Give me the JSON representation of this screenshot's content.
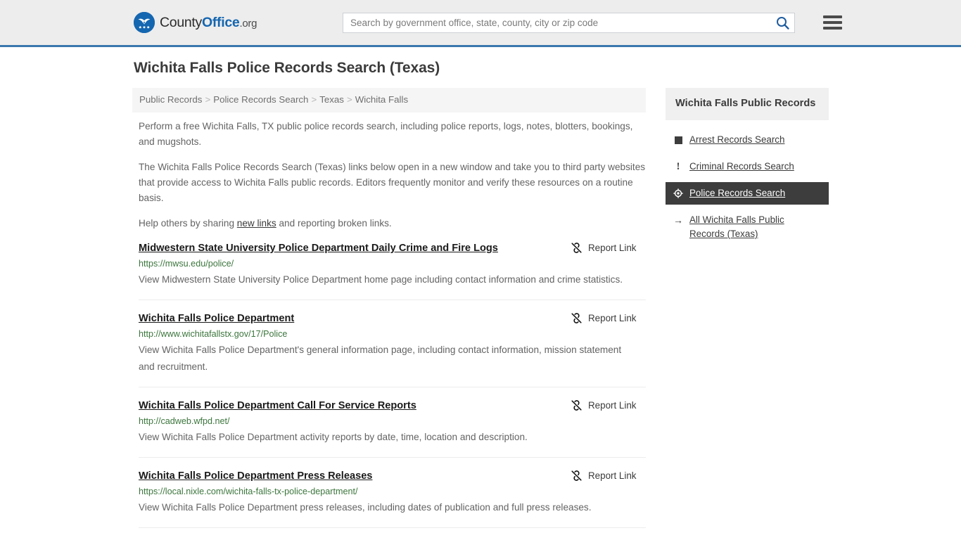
{
  "header": {
    "brand": {
      "part1": "County",
      "part2": "Office",
      "part3": ".org",
      "logo_icon": "eagle-shield-logo"
    },
    "search": {
      "placeholder": "Search by government office, state, county, city or zip code",
      "value": "",
      "search_icon": "search-icon"
    },
    "menu_icon": "hamburger-menu-icon",
    "accent_color": "#3a77ad",
    "background_color": "#ededed"
  },
  "page": {
    "title": "Wichita Falls Police Records Search (Texas)"
  },
  "breadcrumb": {
    "separator": ">",
    "items": [
      {
        "label": "Public Records"
      },
      {
        "label": "Police Records Search"
      },
      {
        "label": "Texas"
      },
      {
        "label": "Wichita Falls"
      }
    ]
  },
  "intro": {
    "paragraph1": "Perform a free Wichita Falls, TX public police records search, including police reports, logs, notes, blotters, bookings, and mugshots.",
    "paragraph2": "The Wichita Falls Police Records Search (Texas) links below open in a new window and take you to third party websites that provide access to Wichita Falls public records. Editors frequently monitor and verify these resources on a routine basis.",
    "paragraph3_before": "Help others by sharing ",
    "paragraph3_link": "new links",
    "paragraph3_after": " and reporting broken links."
  },
  "results": {
    "report_link_label": "Report Link",
    "report_link_icon": "broken-link-icon",
    "items": [
      {
        "title": "Midwestern State University Police Department Daily Crime and Fire Logs",
        "url": "https://mwsu.edu/police/",
        "description": "View Midwestern State University Police Department home page including contact information and crime statistics."
      },
      {
        "title": "Wichita Falls Police Department",
        "url": "http://www.wichitafallstx.gov/17/Police",
        "description": "View Wichita Falls Police Department's general information page, including contact information, mission statement and recruitment."
      },
      {
        "title": "Wichita Falls Police Department Call For Service Reports",
        "url": "http://cadweb.wfpd.net/",
        "description": "View Wichita Falls Police Department activity reports by date, time, location and description."
      },
      {
        "title": "Wichita Falls Police Department Press Releases",
        "url": "https://local.nixle.com/wichita-falls-tx-police-department/",
        "description": "View Wichita Falls Police Department press releases, including dates of publication and full press releases."
      }
    ]
  },
  "sidebar": {
    "title": "Wichita Falls Public Records",
    "active_background": "#3d3d3d",
    "items": [
      {
        "label": "Arrest Records Search",
        "icon": "square-icon",
        "active": false
      },
      {
        "label": "Criminal Records Search",
        "icon": "exclamation-icon",
        "active": false
      },
      {
        "label": "Police Records Search",
        "icon": "target-crosshair-icon",
        "active": true
      },
      {
        "label": "All Wichita Falls Public Records (Texas)",
        "icon": "arrow-right-icon",
        "active": false
      }
    ]
  }
}
